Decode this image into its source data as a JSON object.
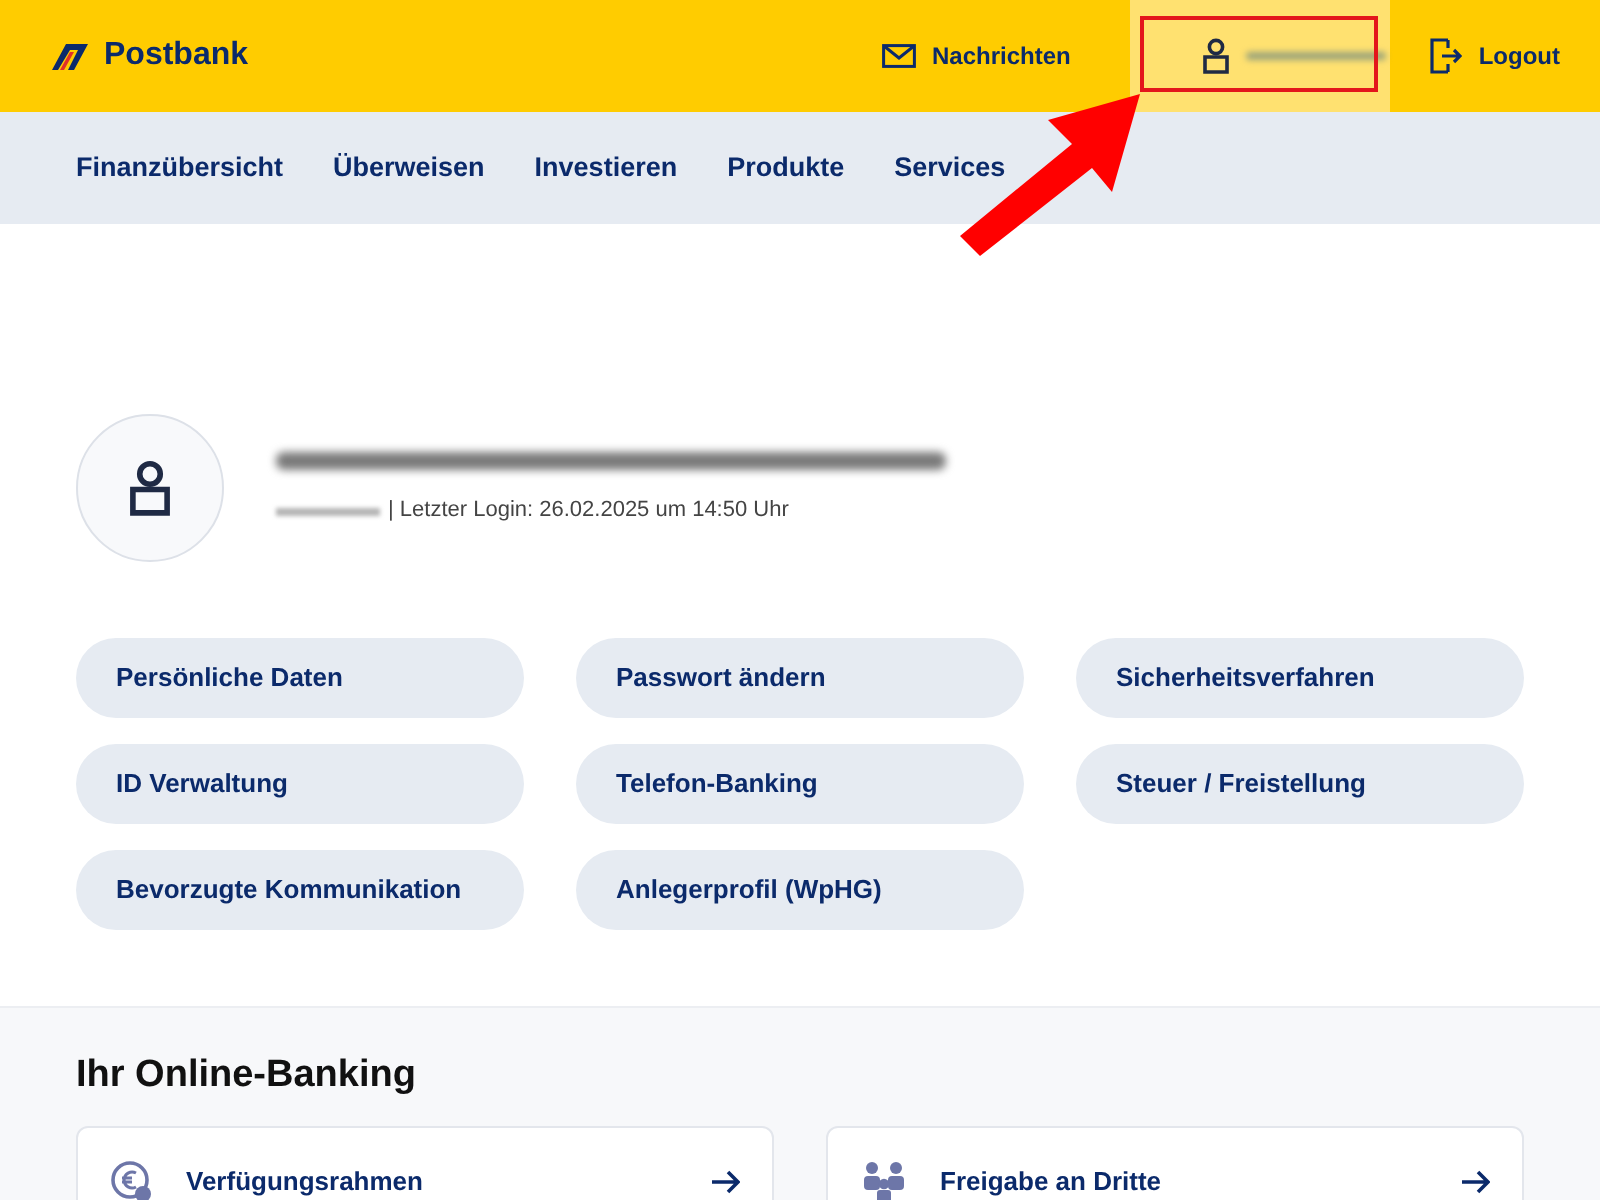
{
  "header": {
    "logo": "Postbank",
    "messages": "Nachrichten",
    "logout": "Logout"
  },
  "nav": [
    "Finanzübersicht",
    "Überweisen",
    "Investieren",
    "Produkte",
    "Services"
  ],
  "profile": {
    "last_login": "| Letzter Login: 26.02.2025 um 14:50 Uhr"
  },
  "actions": [
    "Persönliche Daten",
    "Passwort ändern",
    "Sicherheitsverfahren",
    "ID Verwaltung",
    "Telefon-Banking",
    "Steuer / Freistellung",
    "Bevorzugte Kommunikation",
    "Anlegerprofil (WpHG)"
  ],
  "online_banking": {
    "title": "Ihr Online-Banking",
    "cards": [
      {
        "label": "Verfügungsrahmen",
        "kind": "euro"
      },
      {
        "label": "Freigabe an Dritte",
        "kind": "people"
      }
    ]
  }
}
